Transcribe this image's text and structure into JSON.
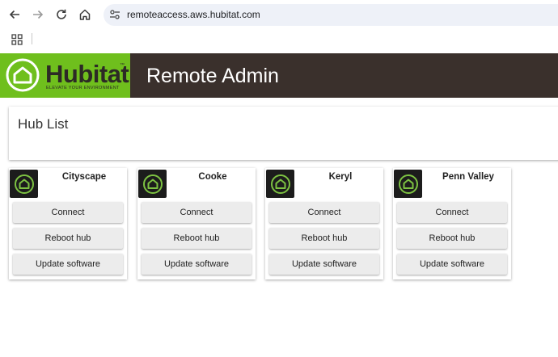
{
  "browser": {
    "url": "remoteaccess.aws.hubitat.com"
  },
  "header": {
    "logo_word": "Hubitat",
    "logo_tm": "™",
    "logo_tagline": "ELEVATE YOUR ENVIRONMENT",
    "title": "Remote Admin",
    "brand_color": "#6fbf1d",
    "bar_color": "#3a302c"
  },
  "hub_list": {
    "title": "Hub List",
    "hubs": [
      {
        "name": "Cityscape",
        "connect_label": "Connect",
        "reboot_label": "Reboot hub",
        "update_label": "Update software"
      },
      {
        "name": "Cooke",
        "connect_label": "Connect",
        "reboot_label": "Reboot hub",
        "update_label": "Update software"
      },
      {
        "name": "Keryl",
        "connect_label": "Connect",
        "reboot_label": "Reboot hub",
        "update_label": "Update software"
      },
      {
        "name": "Penn Valley",
        "connect_label": "Connect",
        "reboot_label": "Reboot hub",
        "update_label": "Update software"
      }
    ]
  },
  "icons": {
    "back": "arrow-left-icon",
    "forward": "arrow-right-icon",
    "reload": "reload-icon",
    "home": "home-icon",
    "site_info": "tune-icon",
    "apps": "apps-grid-icon",
    "hub": "hubitat-hub-icon"
  }
}
